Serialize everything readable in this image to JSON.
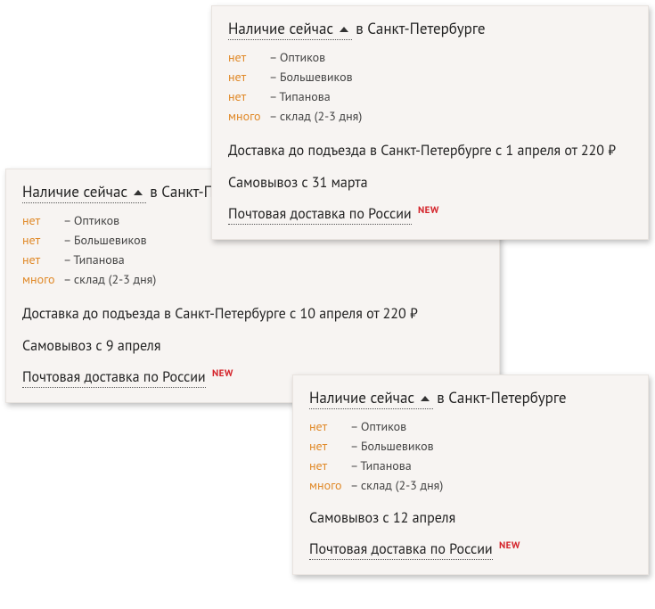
{
  "common": {
    "availability_label": "Наличие сейчас",
    "city_prefix": "в Санкт-Петербурге",
    "postal_label": "Почтовая доставка по России",
    "new_badge": "NEW"
  },
  "stock_rows": [
    {
      "status": "нет",
      "loc": "– Оптиков"
    },
    {
      "status": "нет",
      "loc": "– Большевиков"
    },
    {
      "status": "нет",
      "loc": "– Типанова"
    },
    {
      "status": "много",
      "loc": "– склад (2-3 дня)"
    }
  ],
  "cards": {
    "a": {
      "delivery": "Доставка до подъезда в Санкт-Петербурге с 1 апреля от 220 ₽",
      "pickup": "Самовывоз с 31 марта"
    },
    "b": {
      "delivery": "Доставка до подъезда в Санкт-Петербурге с 10 апреля от 220 ₽",
      "pickup": "Самовывоз с 9 апреля"
    },
    "c": {
      "pickup": "Самовывоз с 12 апреля"
    }
  }
}
